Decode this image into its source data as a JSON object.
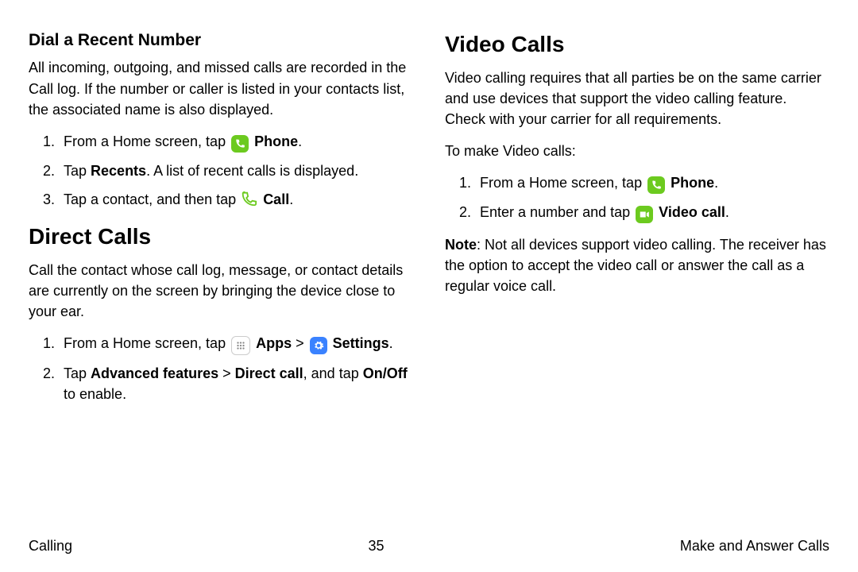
{
  "footer": {
    "left": "Calling",
    "center": "35",
    "right": "Make and Answer Calls"
  },
  "left": {
    "h3": "Dial a Recent Number",
    "p1": "All incoming, outgoing, and missed calls are recorded in the Call log. If the number or caller is listed in your contacts list, the associated name is also displayed.",
    "li1_a": "From a Home screen, tap ",
    "li1_b": "Phone",
    "li1_c": ".",
    "li2_a": "Tap ",
    "li2_b": "Recents",
    "li2_c": ". A list of recent calls is displayed.",
    "li3_a": "Tap a contact, and then tap ",
    "li3_b": "Call",
    "li3_c": ".",
    "h2": "Direct Calls",
    "p2": "Call the contact whose call log, message, or contact details are currently on the screen by bringing the device close to your ear.",
    "dc_li1_a": "From a Home screen, tap ",
    "dc_li1_b": "Apps",
    "dc_li1_sep": " > ",
    "dc_li1_c": "Settings",
    "dc_li1_d": ".",
    "dc_li2_a": "Tap ",
    "dc_li2_b": "Advanced features",
    "dc_li2_c": "Direct call",
    "dc_li2_d": ", and tap ",
    "dc_li2_e": "On/Off",
    "dc_li2_f": " to enable."
  },
  "right": {
    "h2": "Video Calls",
    "p1": "Video calling requires that all parties be on the same carrier and use devices that support the video calling feature. Check with your carrier for all requirements.",
    "p2": "To make Video calls:",
    "li1_a": "From a Home screen, tap ",
    "li1_b": "Phone",
    "li1_c": ".",
    "li2_a": "Enter a number and tap ",
    "li2_b": "Video call",
    "li2_c": ".",
    "note_a": "Note",
    "note_b": ": Not all devices support video calling. The receiver has the option to accept the video call or answer the call as a regular voice call."
  }
}
